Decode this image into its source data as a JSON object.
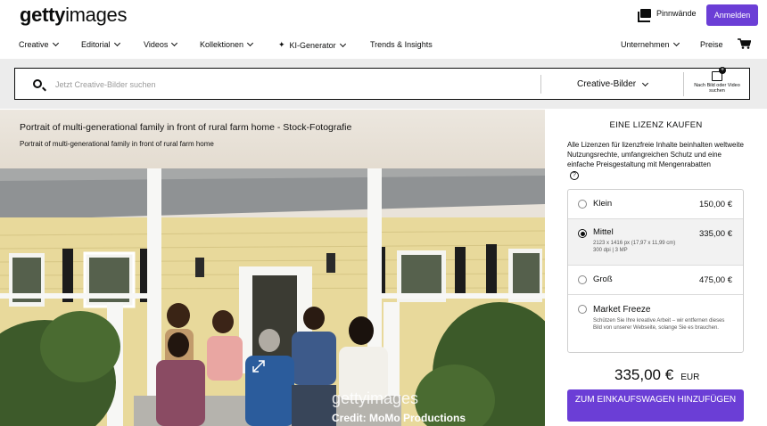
{
  "header": {
    "logo_bold": "getty",
    "logo_light": "images",
    "pinnwaende": "Pinnwände",
    "login": "Anmelden"
  },
  "nav": {
    "items": [
      "Creative",
      "Editorial",
      "Videos",
      "Kollektionen",
      "KI-Generator",
      "Trends & Insights",
      "Unternehmen",
      "Preise"
    ]
  },
  "search": {
    "placeholder": "Jetzt Creative-Bilder suchen",
    "type": "Creative-Bilder",
    "image_search": "Nach Bild oder Video suchen"
  },
  "image": {
    "title": "Portrait of multi-generational family in front of rural farm home - Stock-Fotografie",
    "caption": "Portrait of multi-generational family in front of rural farm home",
    "watermark": "gettyimages",
    "credit": "Credit: MoMo Productions"
  },
  "license": {
    "heading": "EINE LIZENZ KAUFEN",
    "description": "Alle Lizenzen für lizenzfreie Inhalte beinhalten weltweite Nutzungsrechte, umfangreichen Schutz und eine einfache Preisgestaltung mit Mengenrabatten",
    "options": [
      {
        "name": "Klein",
        "price": "150,00 €",
        "detail": "",
        "selected": false
      },
      {
        "name": "Mittel",
        "price": "335,00 €",
        "detail": "2123 x 1416 px (17,97 x 11,99 cm)\n300 dpi | 3 MP",
        "selected": true
      },
      {
        "name": "Groß",
        "price": "475,00 €",
        "detail": "",
        "selected": false
      },
      {
        "name": "Market Freeze",
        "price": "",
        "detail": "Schützen Sie Ihre kreative Arbeit – wir entfernen dieses Bild von unserer Webseite, solange Sie es brauchen.",
        "selected": false
      }
    ],
    "total_amount": "335,00 €",
    "total_currency": "EUR",
    "add_to_cart": "ZUM EINKAUFSWAGEN HINZUFÜGEN"
  },
  "colors": {
    "accent": "#6b3ed6"
  }
}
